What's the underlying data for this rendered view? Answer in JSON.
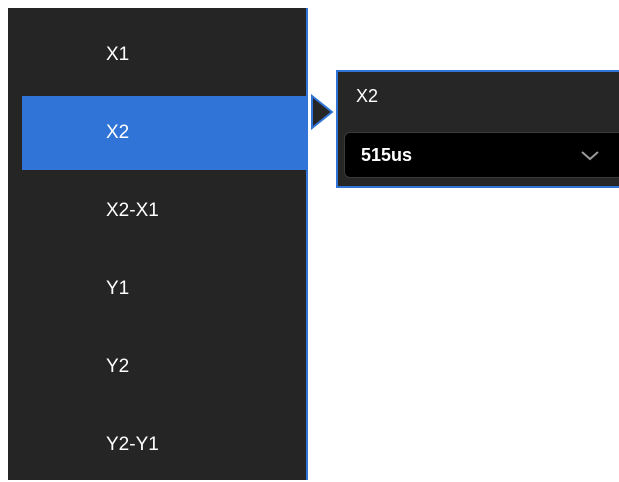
{
  "menu": {
    "items": [
      {
        "label": "X1"
      },
      {
        "label": "X2"
      },
      {
        "label": "X2-X1"
      },
      {
        "label": "Y1"
      },
      {
        "label": "Y2"
      },
      {
        "label": "Y2-Y1"
      }
    ],
    "selected_index": 1
  },
  "submenu": {
    "title": "X2",
    "value": "515us"
  },
  "colors": {
    "accent": "#2f74d6",
    "menu_background": "#252525",
    "panel_background": "#262626",
    "select_background": "#000000"
  },
  "icons": {
    "submenu_arrow": "triangle-right-icon",
    "dropdown": "chevron-down-icon"
  }
}
